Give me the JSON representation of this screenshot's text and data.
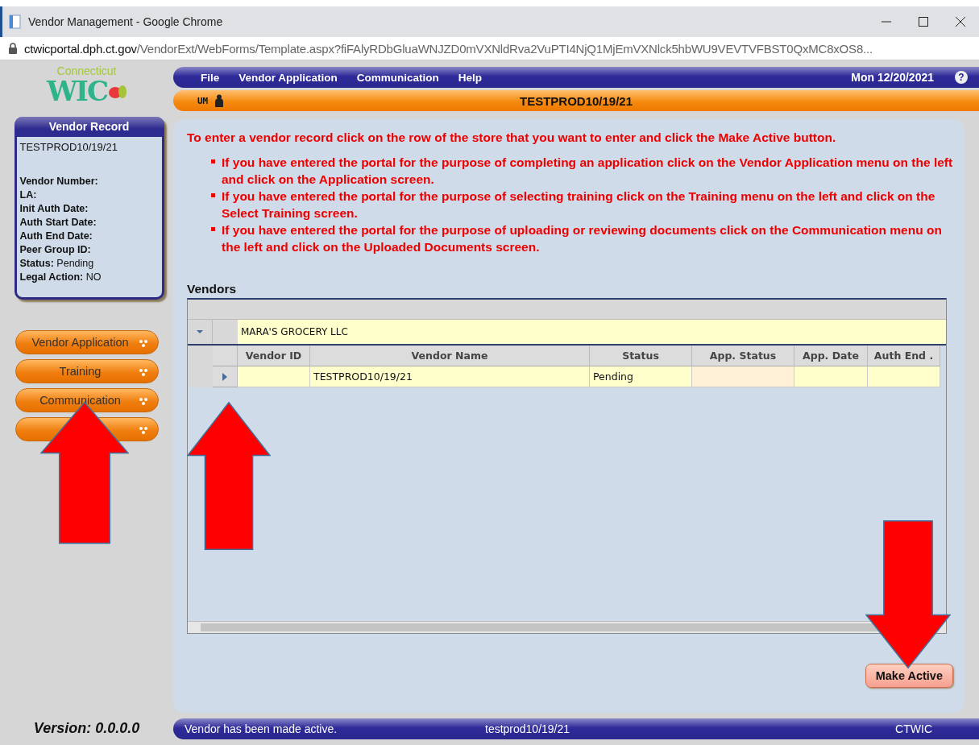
{
  "window": {
    "title": "Vendor Management - Google Chrome",
    "url_host": "ctwicportal.dph.ct.gov",
    "url_path": "/VendorExt/WebForms/Template.aspx?fiFAlyRDbGluaWNJZD0mVXNldRva2VuPTI4NjQ1MjEmVXNlck5hbWU9VEVTVFBST0QxMC8xOS8..."
  },
  "logo": {
    "state": "Connecticut",
    "brand": "WIC"
  },
  "menu": {
    "items": [
      "File",
      "Vendor Application",
      "Communication",
      "Help"
    ],
    "date": "Mon 12/20/2021",
    "help": "?"
  },
  "header": {
    "badge": "UM",
    "title": "TESTPROD10/19/21"
  },
  "vendor_record": {
    "title": "Vendor Record",
    "name": "TESTPROD10/19/21",
    "fields": [
      {
        "label": "Vendor Number:"
      },
      {
        "label": "LA:"
      },
      {
        "label": "Init Auth Date:"
      },
      {
        "label": "Auth Start Date:"
      },
      {
        "label": "Auth End Date:"
      },
      {
        "label": "Peer Group ID:"
      },
      {
        "label": "Status:",
        "value": "Pending"
      },
      {
        "label": "Legal Action:",
        "value": "NO"
      }
    ]
  },
  "nav": [
    {
      "label": "Vendor Application"
    },
    {
      "label": "Training"
    },
    {
      "label": "Communication"
    },
    {
      "kind": "covered"
    }
  ],
  "instructions": {
    "intro": "To enter a vendor record click on the row of the store that you want to enter and click the Make Active button.",
    "bullets": [
      "If you have entered the portal for the purpose of completing an application click on the Vendor Application menu on the left and click on the Application screen.",
      "If you have entered the portal for the purpose of selecting training click on the Training menu on the left and click on the Select Training screen.",
      "If you have entered the portal for the purpose of uploading or reviewing documents click on the Communication menu on the left and click on the Uploaded Documents screen."
    ]
  },
  "vendors": {
    "title": "Vendors",
    "group": {
      "name": "MARA'S GROCERY LLC",
      "expanded": true
    },
    "columns": [
      "Vendor ID",
      "Vendor Name",
      "Status",
      "App. Status",
      "App. Date",
      "Auth End ."
    ],
    "rows": [
      {
        "cells": [
          "",
          "TESTPROD10/19/21",
          "Pending",
          "",
          "",
          ""
        ]
      }
    ]
  },
  "make_active": "Make Active",
  "version": "Version: 0.0.0.0",
  "status_bar": {
    "message": "Vendor has been made active.",
    "user": "testprod10/19/21",
    "site": "CTWIC"
  }
}
